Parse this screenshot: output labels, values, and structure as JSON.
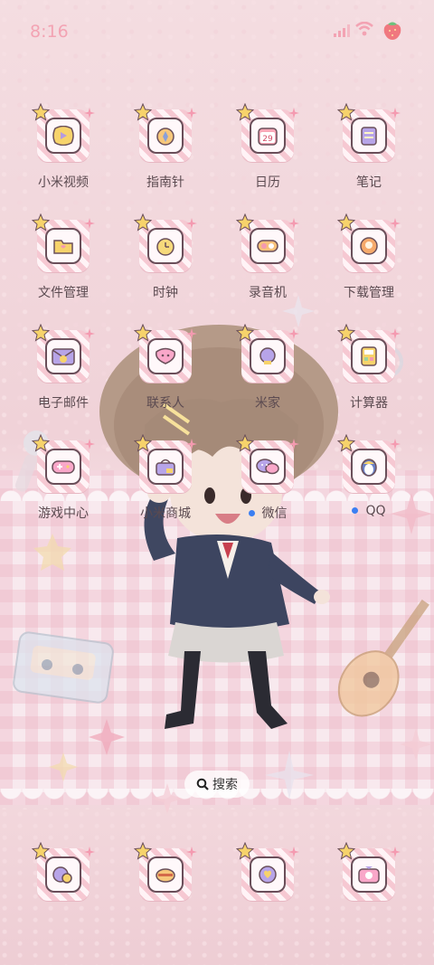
{
  "status_bar": {
    "time": "8:16",
    "battery_icon": "strawberry-battery-icon"
  },
  "apps": [
    {
      "label": "小米视频",
      "icon": "video-play-icon",
      "dot": false
    },
    {
      "label": "指南针",
      "icon": "compass-icon",
      "dot": false
    },
    {
      "label": "日历",
      "icon": "calendar-icon",
      "date": "29",
      "dot": false
    },
    {
      "label": "笔记",
      "icon": "notes-icon",
      "dot": false
    },
    {
      "label": "文件管理",
      "icon": "folder-icon",
      "dot": false
    },
    {
      "label": "时钟",
      "icon": "clock-icon",
      "dot": false
    },
    {
      "label": "录音机",
      "icon": "recorder-icon",
      "dot": false
    },
    {
      "label": "下载管理",
      "icon": "download-icon",
      "dot": false
    },
    {
      "label": "电子邮件",
      "icon": "mail-icon",
      "dot": false
    },
    {
      "label": "联系人",
      "icon": "contacts-icon",
      "dot": false
    },
    {
      "label": "米家",
      "icon": "mijia-icon",
      "dot": false
    },
    {
      "label": "计算器",
      "icon": "calculator-icon",
      "dot": false
    },
    {
      "label": "游戏中心",
      "icon": "gamepad-icon",
      "dot": false
    },
    {
      "label": "小米商城",
      "icon": "shop-icon",
      "dot": false
    },
    {
      "label": "微信",
      "icon": "wechat-icon",
      "dot": true
    },
    {
      "label": "QQ",
      "icon": "qq-penguin-icon",
      "dot": true
    }
  ],
  "search": {
    "label": "搜索"
  },
  "dock": [
    {
      "icon": "dock-phone-icon"
    },
    {
      "icon": "dock-messages-icon"
    },
    {
      "icon": "dock-browser-icon"
    },
    {
      "icon": "dock-camera-icon"
    }
  ],
  "colors": {
    "accent": "#f3a3b3",
    "dot": "#3b7ff2",
    "outline": "#6a4f5a"
  }
}
